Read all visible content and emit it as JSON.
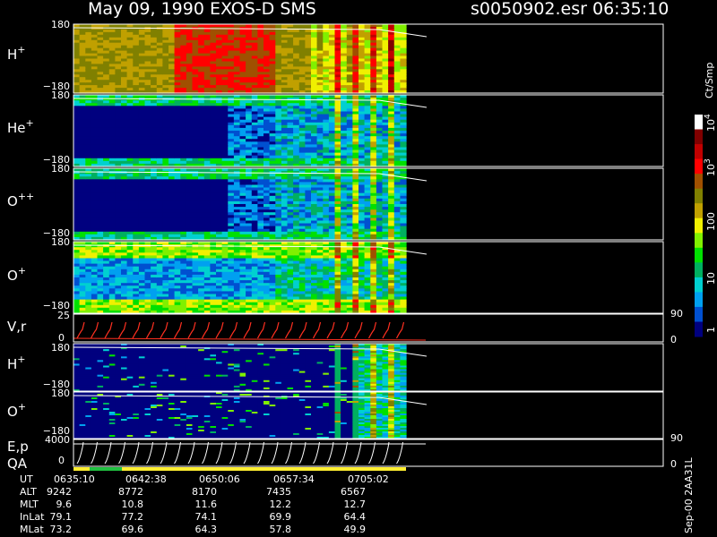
{
  "header": {
    "title_left": "May 09, 1990   EXOS-D SMS",
    "title_right": "s0050902.esr  06:35:10"
  },
  "colorbar": {
    "unit": "Ct/Smp",
    "ticks": [
      "1",
      "10",
      "100",
      "10",
      "10"
    ],
    "exponents": [
      "3",
      "4"
    ],
    "colors": [
      "#00007f",
      "#0050d0",
      "#00a0f0",
      "#00d0d0",
      "#00b060",
      "#00e000",
      "#80f000",
      "#f0f000",
      "#c0a000",
      "#808000",
      "#a05000",
      "#ff0000",
      "#c00000",
      "#800000",
      "#ffffff"
    ]
  },
  "panels": [
    {
      "id": "h-plus",
      "label": "H",
      "sup": "+",
      "ytop": "180",
      "ybot": "−180"
    },
    {
      "id": "he-plus",
      "label": "He",
      "sup": "+",
      "ytop": "180",
      "ybot": "−180"
    },
    {
      "id": "o-plusplus",
      "label": "O",
      "sup": "++",
      "ytop": "180",
      "ybot": "−180"
    },
    {
      "id": "o-plus",
      "label": "O",
      "sup": "+",
      "ytop": "180",
      "ybot": "−180"
    },
    {
      "id": "vr",
      "label": "V,r",
      "sup": "",
      "ytop": "25",
      "ybot": "0",
      "rtop": "90",
      "rbot": "0"
    },
    {
      "id": "h-plus-2",
      "label": "H",
      "sup": "+",
      "ytop": "180",
      "ybot": "−180"
    },
    {
      "id": "o-plus-2",
      "label": "O",
      "sup": "+",
      "ytop": "180",
      "ybot": "−180"
    },
    {
      "id": "ep-qa",
      "label": "E,p",
      "label2": "QA",
      "sup": "",
      "ytop": "4000",
      "ybot": "0",
      "rtop": "90",
      "rbot": "0"
    }
  ],
  "footer": {
    "rows": [
      {
        "name": "UT",
        "values": [
          "0635:10",
          "0642:38",
          "0650:06",
          "0657:34",
          "0705:02"
        ]
      },
      {
        "name": "ALT",
        "values": [
          "9242",
          "8772",
          "8170",
          "7435",
          "6567"
        ]
      },
      {
        "name": "MLT",
        "values": [
          "9.6",
          "10.8",
          "11.6",
          "12.2",
          "12.7"
        ]
      },
      {
        "name": "InLat",
        "values": [
          "79.1",
          "77.2",
          "74.1",
          "69.9",
          "64.4"
        ]
      },
      {
        "name": "MLat",
        "values": [
          "73.2",
          "69.6",
          "64.3",
          "57.8",
          "49.9"
        ]
      }
    ],
    "side_label": "Sep-00 2AA31L"
  }
}
